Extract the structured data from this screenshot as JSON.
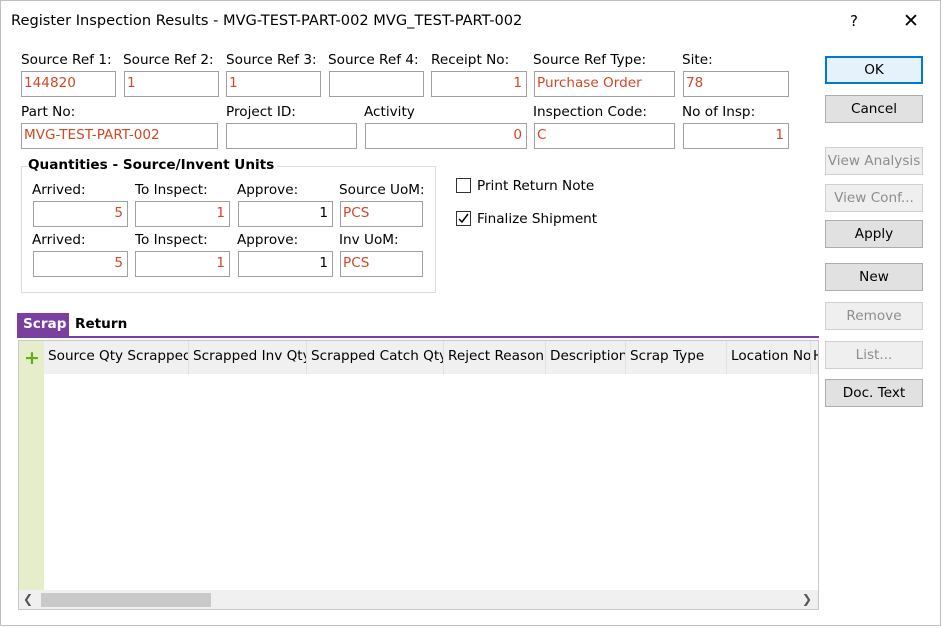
{
  "window": {
    "title": "Register Inspection Results - MVG-TEST-PART-002 MVG_TEST-PART-002",
    "help": "?",
    "close": "✕"
  },
  "fields": {
    "source_ref1": {
      "label": "Source Ref 1:",
      "value": "144820"
    },
    "source_ref2": {
      "label": "Source Ref 2:",
      "value": "1"
    },
    "source_ref3": {
      "label": "Source Ref 3:",
      "value": "1"
    },
    "source_ref4": {
      "label": "Source Ref 4:",
      "value": ""
    },
    "receipt_no": {
      "label": "Receipt No:",
      "value": "1"
    },
    "source_ref_type": {
      "label": "Source Ref Type:",
      "value": "Purchase Order"
    },
    "site": {
      "label": "Site:",
      "value": "78"
    },
    "part_no": {
      "label": "Part No:",
      "value": "MVG-TEST-PART-002"
    },
    "project_id": {
      "label": "Project ID:",
      "value": ""
    },
    "activity": {
      "label": "Activity",
      "value": "0"
    },
    "inspection_code": {
      "label": "Inspection Code:",
      "value": "C"
    },
    "no_of_insp": {
      "label": "No of Insp:",
      "value": "1"
    }
  },
  "quantities": {
    "title": "Quantities - Source/Invent Units",
    "source_row": {
      "arrived_label": "Arrived:",
      "arrived": "5",
      "to_inspect_label": "To Inspect:",
      "to_inspect": "1",
      "approve_label": "Approve:",
      "approve": "1",
      "uom_label": "Source UoM:",
      "uom": "PCS"
    },
    "inv_row": {
      "arrived_label": "Arrived:",
      "arrived": "5",
      "to_inspect_label": "To Inspect:",
      "to_inspect": "1",
      "approve_label": "Approve:",
      "approve": "1",
      "uom_label": "Inv UoM:",
      "uom": "PCS"
    }
  },
  "checkboxes": {
    "print_return_note": {
      "label": "Print Return Note",
      "checked": false
    },
    "finalize_shipment": {
      "label": "Finalize Shipment",
      "checked": true
    }
  },
  "buttons": {
    "ok": "OK",
    "cancel": "Cancel",
    "view_analysis": "View Analysis",
    "view_conf": "View Conf...",
    "apply": "Apply",
    "new": "New",
    "remove": "Remove",
    "list": "List...",
    "doc_text": "Doc. Text"
  },
  "tabs": [
    "Scrap",
    "Return"
  ],
  "grid": {
    "columns": [
      "Source Qty Scrapped",
      "Scrapped Inv Qty",
      "Scrapped Catch Qty",
      "Reject Reason",
      "Description",
      "Scrap Type",
      "Location No",
      "H"
    ],
    "rows": []
  },
  "colors": {
    "accent": "#7b3fa0",
    "value_text": "#d24726",
    "default_button_border": "#0078d7",
    "add_icon": "#62a820"
  }
}
